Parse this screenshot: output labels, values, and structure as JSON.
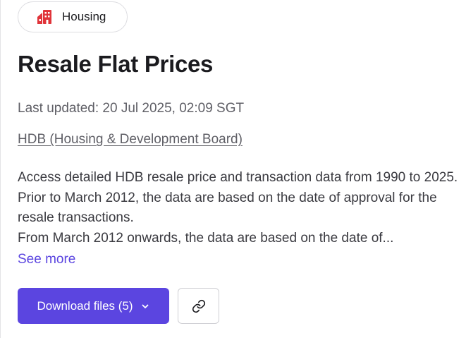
{
  "tag": {
    "label": "Housing",
    "icon": "building-icon",
    "icon_color": "#e0343a"
  },
  "dataset": {
    "title": "Resale Flat Prices",
    "last_updated": "Last updated: 20 Jul 2025, 02:09 SGT",
    "agency": "HDB (Housing & Development Board)",
    "description_line_1": "Access detailed HDB resale price and transaction data from 1990 to 2025. Prior to March 2012, the data are based on the date of approval for the resale transactions.",
    "description_line_2": "From March 2012 onwards, the data are based on the date of...",
    "see_more": "See more"
  },
  "actions": {
    "download_label": "Download files (5)",
    "download_icon": "chevron-down-icon",
    "copy_link_icon": "link-icon",
    "accent_color": "#5b45e0"
  }
}
